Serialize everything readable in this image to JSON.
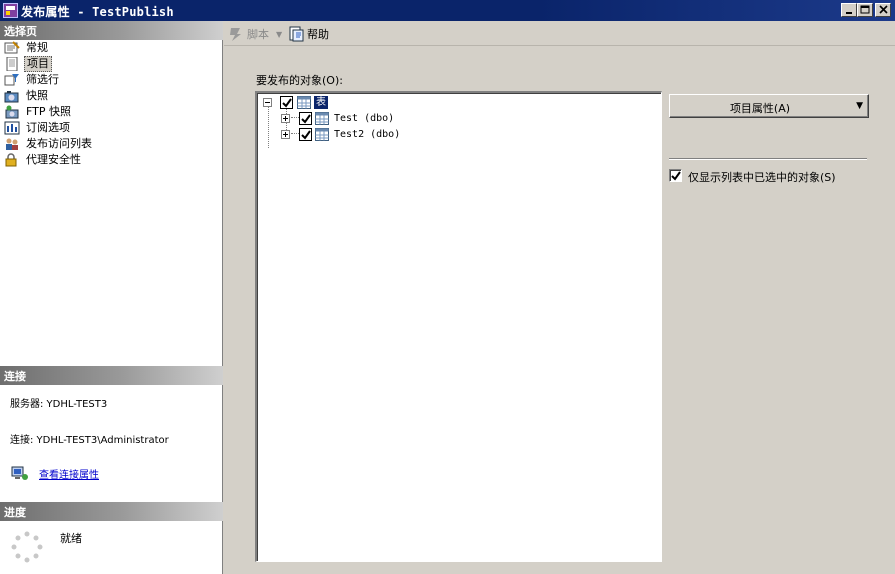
{
  "window": {
    "title_cn": "发布属性",
    "title_sep": " - ",
    "title_name": "TestPublish"
  },
  "left": {
    "select_page_header": "选择页",
    "nav_items": [
      {
        "label": "常规",
        "icon": "general-icon"
      },
      {
        "label": "项目",
        "icon": "articles-icon",
        "selected": true
      },
      {
        "label": "筛选行",
        "icon": "filter-rows-icon"
      },
      {
        "label": "快照",
        "icon": "snapshot-icon"
      },
      {
        "label": "FTP 快照",
        "icon": "ftp-snapshot-icon"
      },
      {
        "label": "订阅选项",
        "icon": "subscription-options-icon"
      },
      {
        "label": "发布访问列表",
        "icon": "access-list-icon"
      },
      {
        "label": "代理安全性",
        "icon": "agent-security-icon"
      }
    ],
    "connection_header": "连接",
    "server_label": "服务器: YDHL-TEST3",
    "connection_label": "连接: YDHL-TEST3\\Administrator",
    "view_connection_link": "查看连接属性",
    "progress_header": "进度",
    "progress_status": "就绪"
  },
  "toolbar": {
    "script_label": "脚本",
    "help_label": "帮助"
  },
  "main": {
    "objects_label": "要发布的对象(O):",
    "tree": {
      "root_label": "表",
      "children": [
        {
          "label": "Test (dbo)",
          "checked": true
        },
        {
          "label": "Test2 (dbo)",
          "checked": true
        }
      ]
    },
    "article_properties_label": "项目属性(A)",
    "show_only_checked_label": "仅显示列表中已选中的对象(S)",
    "show_only_checked": true
  },
  "colors": {
    "titlebar": "#0a246a",
    "window_bg": "#d4d0c8",
    "link": "#0000cc",
    "selection": "#0a246a"
  }
}
